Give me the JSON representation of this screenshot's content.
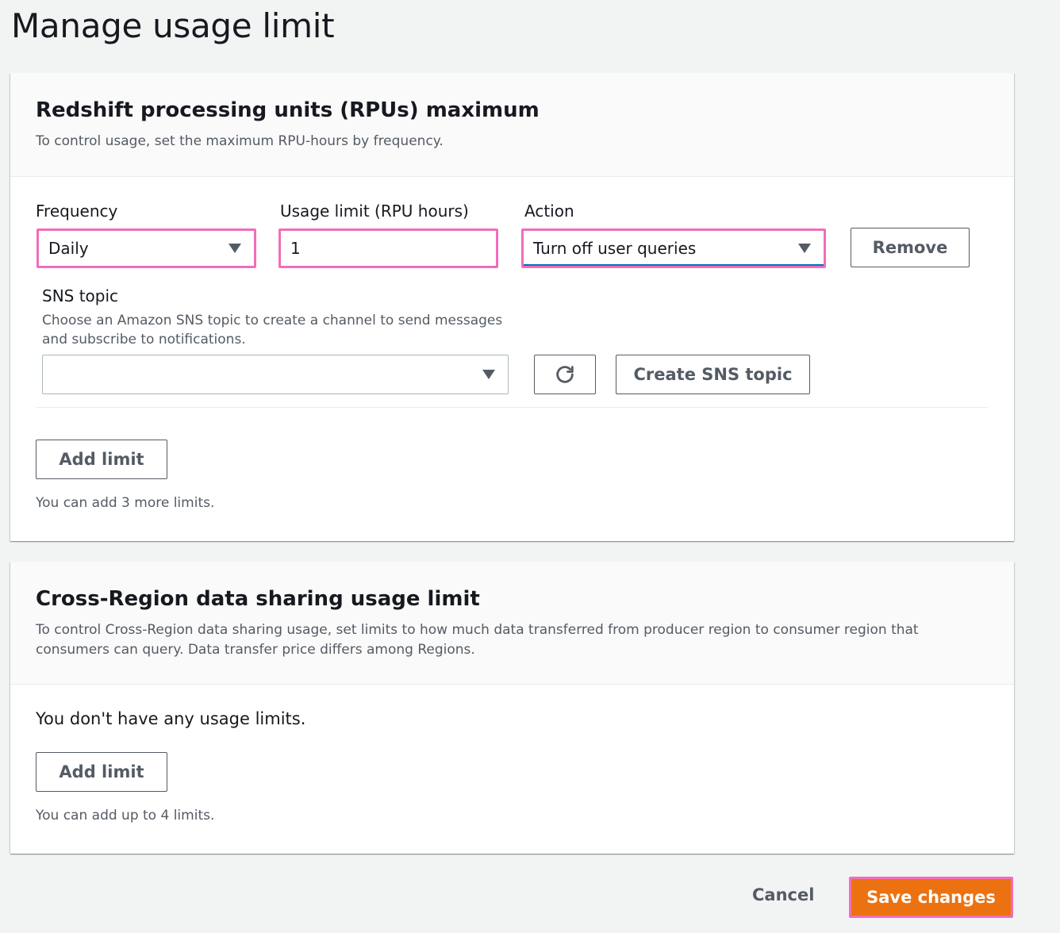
{
  "page": {
    "title": "Manage usage limit"
  },
  "rpu_section": {
    "title": "Redshift processing units (RPUs) maximum",
    "description": "To control usage, set the maximum RPU-hours by frequency.",
    "frequency": {
      "label": "Frequency",
      "value": "Daily"
    },
    "usage_limit": {
      "label": "Usage limit (RPU hours)",
      "value": "1"
    },
    "action": {
      "label": "Action",
      "value": "Turn off user queries"
    },
    "remove_label": "Remove",
    "sns": {
      "label": "SNS topic",
      "description_line1": "Choose an Amazon SNS topic to create a channel to send messages",
      "description_line2": "and subscribe to notifications.",
      "value": "",
      "refresh_icon": "refresh-icon",
      "create_label": "Create SNS topic"
    },
    "add_limit_label": "Add limit",
    "remaining_hint": "You can add 3 more limits."
  },
  "cross_region_section": {
    "title": "Cross-Region data sharing usage limit",
    "description_line1": "To control Cross-Region data sharing usage, set limits to how much data transferred from producer region to consumer region that",
    "description_line2": "consumers can query. Data transfer price differs among Regions.",
    "empty_text": "You don't have any usage limits.",
    "add_limit_label": "Add limit",
    "remaining_hint": "You can add up to 4 limits."
  },
  "footer": {
    "cancel_label": "Cancel",
    "save_label": "Save changes"
  },
  "colors": {
    "primary": "#ec7211",
    "highlight": "#f06ebb",
    "text_secondary": "#545b64"
  }
}
